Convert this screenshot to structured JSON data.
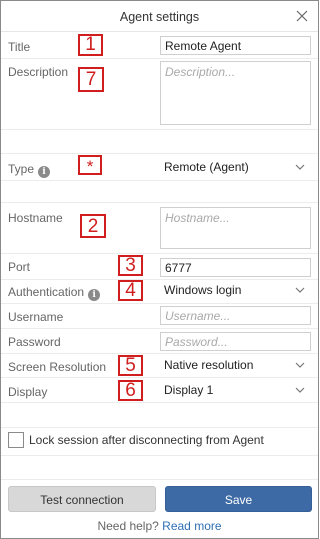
{
  "dialog": {
    "title": "Agent settings"
  },
  "fields": {
    "title": {
      "label": "Title",
      "value": "Remote Agent"
    },
    "description": {
      "label": "Description",
      "placeholder": "Description..."
    },
    "type": {
      "label": "Type",
      "value": "Remote (Agent)"
    },
    "hostname": {
      "label": "Hostname",
      "placeholder": "Hostname..."
    },
    "port": {
      "label": "Port",
      "value": "6777"
    },
    "authentication": {
      "label": "Authentication",
      "value": "Windows login"
    },
    "username": {
      "label": "Username",
      "placeholder": "Username..."
    },
    "password": {
      "label": "Password",
      "placeholder": "Password..."
    },
    "screen_resolution": {
      "label": "Screen Resolution",
      "value": "Native resolution"
    },
    "display": {
      "label": "Display",
      "value": "Display 1"
    }
  },
  "lock_session": {
    "label": "Lock session after disconnecting from Agent",
    "checked": false
  },
  "buttons": {
    "test": "Test connection",
    "save": "Save"
  },
  "help": {
    "text": "Need help?",
    "link": "Read more"
  },
  "annotations": {
    "title": "1",
    "description": "7",
    "type": "*",
    "hostname": "2",
    "port": "3",
    "authentication": "4",
    "screen_resolution": "5",
    "display": "6",
    "color": "#d01e1e"
  },
  "icons": {
    "close": "close-icon",
    "info": "info-icon",
    "chevron": "chevron-down-icon"
  },
  "colors": {
    "save_button": "#3d6aa5",
    "test_button": "#d8d8d8",
    "link": "#2e6fb5",
    "annotation": "#d01e1e"
  }
}
